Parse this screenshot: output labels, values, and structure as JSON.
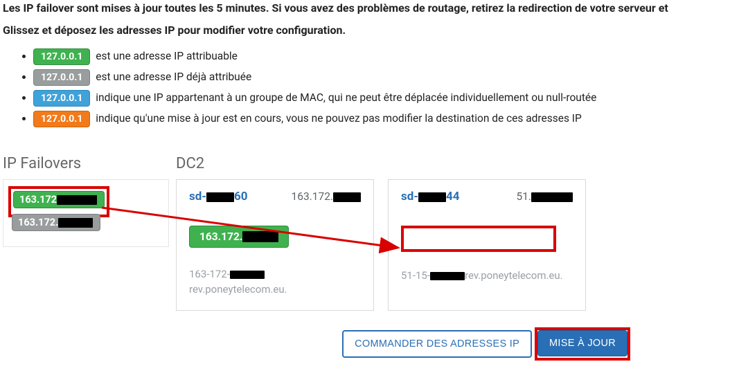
{
  "intro": {
    "line1": "Les IP failover sont mises à jour toutes les 5 minutes. Si vous avez des problèmes de routage, retirez la redirection de votre serveur et",
    "line2": "Glissez et déposez les adresses IP pour modifier votre configuration."
  },
  "legend": {
    "sample_ip": "127.0.0.1",
    "green": "est une adresse IP attribuable",
    "gray": "est une adresse IP déjà attribuée",
    "blue": "indique une IP appartenant à un groupe de MAC, qui ne peut être déplacée individuellement ou null-routée",
    "orange": "indique qu'une mise à jour est en cours, vous ne pouvez pas modifier la destination de ces adresses IP"
  },
  "sections": {
    "failovers_title": "IP Failovers",
    "dc_title": "DC2"
  },
  "failovers": {
    "ip1_prefix": "163.172",
    "ip2_prefix": "163.172."
  },
  "servers": [
    {
      "name_prefix": "sd-",
      "name_suffix": "60",
      "primary_ip_prefix": "163.172.",
      "slot_ip_prefix": "163.172.",
      "reverse_prefix": "163-172-",
      "reverse_suffix": "rev.poneytelecom.eu."
    },
    {
      "name_prefix": "sd-",
      "name_suffix": "44",
      "primary_ip_prefix": "51.",
      "reverse_prefix": "51-15-",
      "reverse_suffix": "rev.poneytelecom.eu."
    }
  ],
  "buttons": {
    "order": "COMMANDER DES ADRESSES IP",
    "update": "MISE À JOUR"
  }
}
